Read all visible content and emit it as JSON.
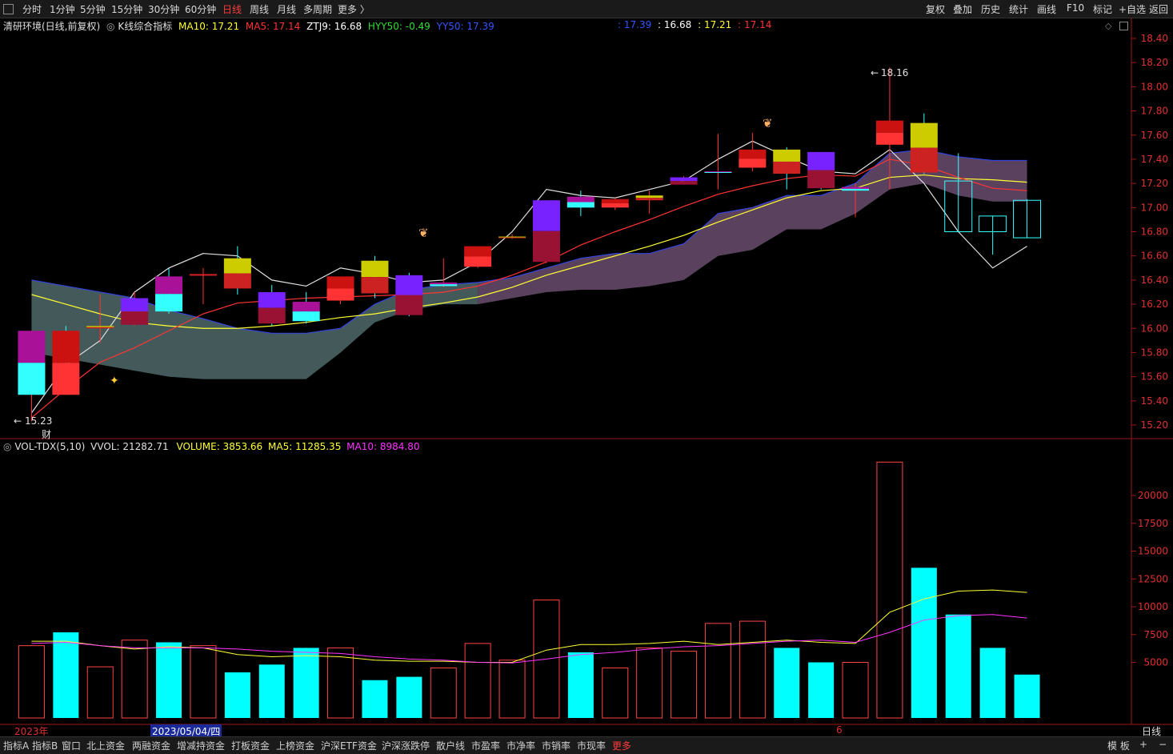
{
  "toolbar": {
    "periods": [
      "分时",
      "1分钟",
      "5分钟",
      "15分钟",
      "30分钟",
      "60分钟",
      "日线",
      "周线",
      "月线",
      "多周期",
      "更多 〉"
    ],
    "active_period": "日线",
    "right": [
      "复权",
      "叠加",
      "历史",
      "统计",
      "画线",
      "F10",
      "标记",
      "+自选",
      "返回"
    ]
  },
  "price_panel": {
    "title": "清研环境(日线,前复权)",
    "indicator": "K线综合指标",
    "ma10_label": "MA10: 17.21",
    "ma5_label": "MA5: 17.14",
    "ztj9_label": "ZTJ9: 16.68",
    "hyy50_label": "HYY50: -0.49",
    "yy50_label": "YY50: 17.39",
    "right_vals": [
      ": 17.39",
      ": 16.68",
      ": 17.21",
      ": 17.14"
    ],
    "high_label": "18.16",
    "low_label": "15.23",
    "cai_label": "财",
    "yticks": [
      "18.40",
      "18.20",
      "18.00",
      "17.80",
      "17.60",
      "17.40",
      "17.20",
      "17.00",
      "16.80",
      "16.60",
      "16.40",
      "16.20",
      "16.00",
      "15.80",
      "15.60",
      "15.40",
      "15.20"
    ],
    "colors": {
      "ma10": "#ffff33",
      "ma5": "#ff3333",
      "ztj9": "#ffffff",
      "hyy50": "#33dd33",
      "yy50": "#3355ff"
    }
  },
  "volume_panel": {
    "title": "VOL-TDX(5,10)",
    "vvol_label": "VVOL: 21282.71",
    "volume_label": "VOLUME: 3853.66",
    "ma5_label": "MA5: 11285.35",
    "ma10_label": "MA10: 8984.80",
    "yticks": [
      "20000",
      "17500",
      "15000",
      "12500",
      "10000",
      "7500",
      "5000"
    ]
  },
  "date_axis": {
    "year": "2023年",
    "date": "2023/05/04/四",
    "month": "6",
    "period": "日线"
  },
  "bottom_tabs": [
    "指标A",
    "指标B",
    "窗口",
    "北上资金",
    "两融资金",
    "增减持资金",
    "打板资金",
    "上榜资金",
    "沪深ETF资金",
    "沪深涨跌停",
    "散户线",
    "市盈率",
    "市净率",
    "市销率",
    "市现率",
    "更多"
  ],
  "bottom_right": [
    "模 板",
    "+",
    "−"
  ],
  "chart_data": {
    "type": "candlestick",
    "ylim_price": [
      15.15,
      18.45
    ],
    "ylim_volume": [
      0,
      23000
    ],
    "candles": [
      {
        "o": 15.45,
        "c": 15.98,
        "h": 15.98,
        "l": 15.23,
        "v": 6500
      },
      {
        "o": 15.98,
        "c": 15.45,
        "h": 16.02,
        "l": 15.45,
        "v": 7700
      },
      {
        "o": 16.0,
        "c": 16.02,
        "h": 16.28,
        "l": 15.88,
        "v": 4600
      },
      {
        "o": 16.03,
        "c": 16.25,
        "h": 16.3,
        "l": 16.02,
        "v": 7000
      },
      {
        "o": 16.43,
        "c": 16.14,
        "h": 16.5,
        "l": 16.12,
        "v": 6800
      },
      {
        "o": 16.44,
        "c": 16.45,
        "h": 16.5,
        "l": 16.2,
        "v": 6500
      },
      {
        "o": 16.58,
        "c": 16.33,
        "h": 16.68,
        "l": 16.28,
        "v": 4100
      },
      {
        "o": 16.3,
        "c": 16.04,
        "h": 16.36,
        "l": 16.02,
        "v": 4800
      },
      {
        "o": 16.22,
        "c": 16.06,
        "h": 16.3,
        "l": 16.04,
        "v": 6300
      },
      {
        "o": 16.23,
        "c": 16.43,
        "h": 16.43,
        "l": 16.2,
        "v": 6300
      },
      {
        "o": 16.56,
        "c": 16.29,
        "h": 16.6,
        "l": 16.25,
        "v": 3400
      },
      {
        "o": 16.44,
        "c": 16.11,
        "h": 16.46,
        "l": 16.1,
        "v": 3700
      },
      {
        "o": 16.35,
        "c": 16.38,
        "h": 16.58,
        "l": 16.34,
        "v": 4500
      },
      {
        "o": 16.51,
        "c": 16.68,
        "h": 16.68,
        "l": 16.5,
        "v": 6700
      },
      {
        "o": 16.76,
        "c": 16.76,
        "h": 16.78,
        "l": 16.74,
        "v": 5200
      },
      {
        "o": 16.55,
        "c": 17.06,
        "h": 17.06,
        "l": 16.54,
        "v": 10600
      },
      {
        "o": 17.09,
        "c": 17.0,
        "h": 17.14,
        "l": 16.93,
        "v": 5900
      },
      {
        "o": 17.0,
        "c": 17.07,
        "h": 17.08,
        "l": 16.98,
        "v": 4500
      },
      {
        "o": 17.06,
        "c": 17.1,
        "h": 17.14,
        "l": 16.95,
        "v": 6300
      },
      {
        "o": 17.19,
        "c": 17.25,
        "h": 17.26,
        "l": 17.19,
        "v": 6000
      },
      {
        "o": 17.29,
        "c": 17.3,
        "h": 17.61,
        "l": 17.15,
        "v": 8500
      },
      {
        "o": 17.33,
        "c": 17.48,
        "h": 17.62,
        "l": 17.3,
        "v": 8700
      },
      {
        "o": 17.48,
        "c": 17.28,
        "h": 17.5,
        "l": 17.15,
        "v": 6300
      },
      {
        "o": 17.46,
        "c": 17.16,
        "h": 17.46,
        "l": 17.15,
        "v": 5000
      },
      {
        "o": 17.14,
        "c": 17.17,
        "h": 17.2,
        "l": 16.92,
        "v": 5000
      },
      {
        "o": 17.52,
        "c": 17.72,
        "h": 18.16,
        "l": 17.15,
        "v": 23000
      },
      {
        "o": 17.7,
        "c": 17.29,
        "h": 17.78,
        "l": 17.28,
        "v": 13500
      },
      {
        "o": 17.22,
        "c": 16.8,
        "h": 17.45,
        "l": 16.8,
        "v": 9300
      },
      {
        "o": 16.93,
        "c": 16.8,
        "h": 16.93,
        "l": 16.61,
        "v": 6300
      },
      {
        "o": 17.06,
        "c": 16.75,
        "h": 17.07,
        "l": 16.75,
        "v": 3900
      }
    ],
    "ma5_price": [
      15.26,
      15.5,
      15.72,
      15.84,
      15.98,
      16.12,
      16.21,
      16.23,
      16.25,
      16.26,
      16.27,
      16.28,
      16.3,
      16.35,
      16.44,
      16.55,
      16.69,
      16.8,
      16.9,
      17.01,
      17.11,
      17.18,
      17.24,
      17.27,
      17.26,
      17.4,
      17.35,
      17.25,
      17.16,
      17.14
    ],
    "ma10_price": [
      16.28,
      16.2,
      16.12,
      16.05,
      16.02,
      16.0,
      16.0,
      16.02,
      16.05,
      16.09,
      16.12,
      16.17,
      16.21,
      16.26,
      16.34,
      16.44,
      16.52,
      16.6,
      16.68,
      16.77,
      16.88,
      16.98,
      17.08,
      17.14,
      17.16,
      17.25,
      17.27,
      17.24,
      17.23,
      17.21
    ],
    "ztj9": [
      15.3,
      15.7,
      15.9,
      16.3,
      16.5,
      16.62,
      16.6,
      16.4,
      16.35,
      16.5,
      16.45,
      16.38,
      16.4,
      16.55,
      16.8,
      17.15,
      17.1,
      17.08,
      17.15,
      17.22,
      17.4,
      17.55,
      17.42,
      17.3,
      17.28,
      17.48,
      17.2,
      16.8,
      16.5,
      16.68
    ],
    "band_top": [
      16.4,
      16.35,
      16.3,
      16.25,
      16.15,
      16.08,
      16.0,
      15.96,
      15.96,
      16.0,
      16.2,
      16.32,
      16.36,
      16.38,
      16.42,
      16.5,
      16.58,
      16.62,
      16.62,
      16.7,
      16.95,
      17.0,
      17.1,
      17.1,
      17.2,
      17.45,
      17.48,
      17.42,
      17.39,
      17.39
    ],
    "band_bot": [
      15.8,
      15.75,
      15.7,
      15.65,
      15.6,
      15.58,
      15.58,
      15.58,
      15.58,
      15.8,
      16.05,
      16.15,
      16.2,
      16.2,
      16.25,
      16.3,
      16.32,
      16.32,
      16.35,
      16.4,
      16.6,
      16.65,
      16.82,
      16.82,
      16.95,
      17.15,
      17.2,
      17.1,
      17.05,
      17.05
    ],
    "vol_ma5": [
      6900,
      6900,
      6500,
      6200,
      6400,
      6300,
      5700,
      5500,
      5600,
      5500,
      5200,
      5100,
      5100,
      5000,
      5000,
      6100,
      6600,
      6600,
      6700,
      6900,
      6600,
      6800,
      7000,
      6800,
      6700,
      9500,
      10700,
      11400,
      11500,
      11285
    ],
    "vol_ma10": [
      6700,
      6800,
      6500,
      6300,
      6300,
      6300,
      6200,
      6000,
      5900,
      5800,
      5500,
      5300,
      5200,
      5000,
      4950,
      5300,
      5700,
      5900,
      6200,
      6400,
      6500,
      6700,
      6900,
      7000,
      6800,
      7700,
      8800,
      9200,
      9300,
      8985
    ]
  }
}
